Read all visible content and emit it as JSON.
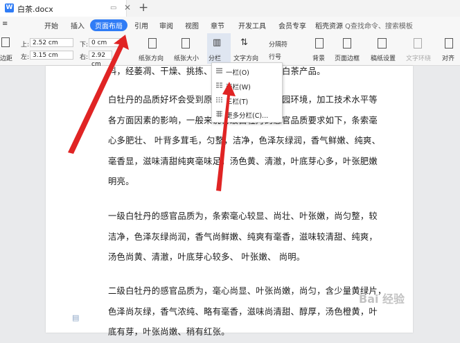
{
  "tab": {
    "title": "白茶.docx",
    "add_label": "+"
  },
  "menu": {
    "items": [
      {
        "label": "开始"
      },
      {
        "label": "插入"
      },
      {
        "label": "页面布局"
      },
      {
        "label": "引用"
      },
      {
        "label": "审阅"
      },
      {
        "label": "视图"
      },
      {
        "label": "章节"
      },
      {
        "label": "开发工具"
      },
      {
        "label": "会员专享"
      },
      {
        "label": "稻壳资源"
      }
    ],
    "search": "Q查找命令、搜索模板"
  },
  "toolbar": {
    "margins_label": "边距",
    "top_label": "上:",
    "top_value": "2.52 cm",
    "left_label": "左:",
    "left_value": "3.15 cm",
    "down_label": "下:",
    "down_value": "0 cm",
    "right_label": "右:",
    "right_value": "2.92 cm",
    "orientation": "纸张方向",
    "size": "纸张大小",
    "columns": "分栏",
    "text_direction": "文字方向",
    "separator": "分隔符",
    "line_number": "行号",
    "background": "背景",
    "page_border": "页面边框",
    "grid_setup": "稿纸设置",
    "text_wrap": "文字环绕",
    "align": "对齐"
  },
  "dropdown": {
    "items": [
      {
        "label": "一栏(O)"
      },
      {
        "label": "两栏(W)"
      },
      {
        "label": "三栏(T)"
      },
      {
        "label": "更多分栏(C)..."
      }
    ]
  },
  "document": {
    "lines": [
      "料，经萎凋、干燥、挑拣、焙火等工序而成的白茶产品。",
      "白牡丹的品质好坏会受到原料、加工环境、茶园环境，加工技术水平等",
      "各方面因素的影响，一般来说特级白牡丹的感官品质要求如下，条索毫",
      "心多肥壮、 叶背多茸毛，匀整，洁净，色泽灰绿润，香气鲜嫩、纯爽、",
      "毫香显，滋味清甜纯爽毫味足，汤色黄、清澈，叶底芽心多，叶张肥嫩",
      "明亮。",
      "一级白牡丹的感官品质为，条索毫心较显、尚壮、叶张嫩，尚匀整，较",
      "洁净，色泽灰绿尚润，香气尚鲜嫩、纯爽有毫香，滋味较清甜、纯爽，",
      "汤色尚黄、清澈，叶底芽心较多、 叶张嫩、 尚明。",
      "二级白牡丹的感官品质为，毫心尚显、叶张尚嫩，尚匀，含少量黄绿片，",
      "色泽尚灰绿，香气浓纯、略有毫香，滋味尚清甜、醇厚，汤色橙黄，叶",
      "底有芽，叶张尚嫩、稍有红张。"
    ]
  },
  "watermark": "Bai 经验"
}
